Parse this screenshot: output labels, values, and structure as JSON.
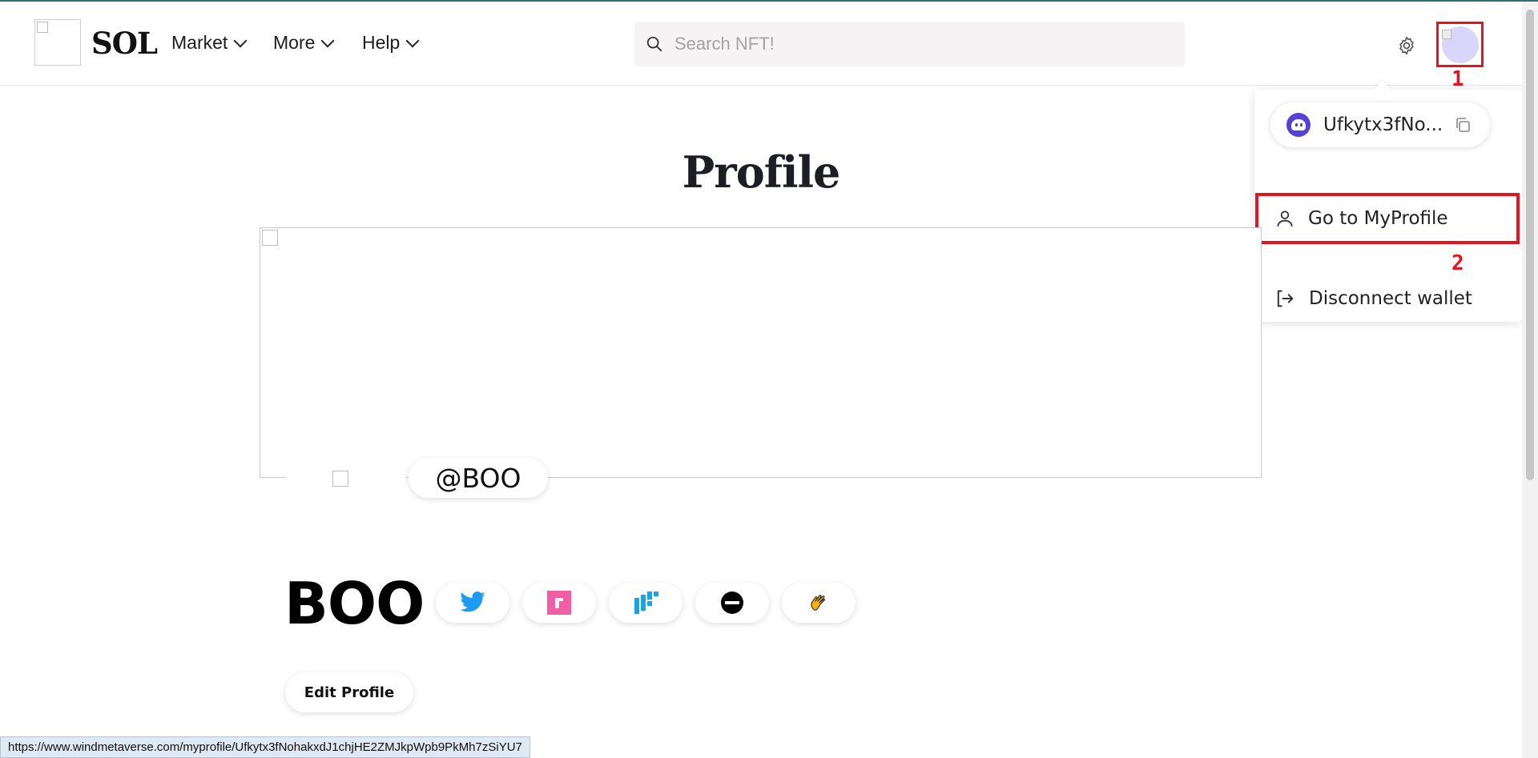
{
  "header": {
    "brand": "SOL",
    "nav": [
      {
        "label": "Market"
      },
      {
        "label": "More"
      },
      {
        "label": "Help"
      }
    ],
    "search": {
      "placeholder": "Search NFT!"
    }
  },
  "annotations": {
    "avatar_marker": "1",
    "menu_marker": "2"
  },
  "dropdown": {
    "wallet_address": "Ufkytx3fNo...",
    "go_to_profile": "Go to MyProfile",
    "disconnect": "Disconnect wallet"
  },
  "profile": {
    "page_title": "Profile",
    "handle": "@BOO",
    "name": "BOO",
    "edit_button": "Edit Profile",
    "social_icons": [
      "twitter-icon",
      "pink-square-icon",
      "blue-blocks-icon",
      "black-circle-icon",
      "waving-hand-icon"
    ]
  },
  "status_bar": {
    "url": "https://www.windmetaverse.com/myprofile/Ufkytx3fNohakxdJ1chjHE2ZMJkpWpb9PkMh7zSiYU7"
  },
  "colors": {
    "accent_red": "#e6141f",
    "phantom_purple": "#5442d6",
    "twitter_blue": "#1d9bf0",
    "avatar_lavender": "#d9d6fb"
  }
}
